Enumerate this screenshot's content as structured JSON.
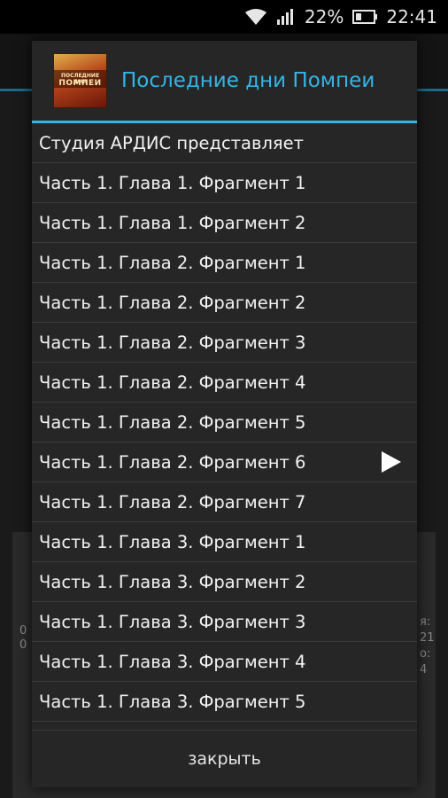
{
  "status_bar": {
    "battery_percent": "22%",
    "time": "22:41"
  },
  "dialog": {
    "title": "Последние дни Помпеи",
    "cover": {
      "line1": "ПОСЛЕДНИЕ ДНИ",
      "line2": "ПОМПЕИ"
    },
    "items": [
      {
        "label": "Студия АРДИС представляет",
        "playing": false
      },
      {
        "label": "Часть 1. Глава 1. Фрагмент 1",
        "playing": false
      },
      {
        "label": "Часть 1. Глава 1. Фрагмент 2",
        "playing": false
      },
      {
        "label": "Часть 1. Глава 2. Фрагмент 1",
        "playing": false
      },
      {
        "label": "Часть 1. Глава 2. Фрагмент 2",
        "playing": false
      },
      {
        "label": "Часть 1. Глава 2. Фрагмент 3",
        "playing": false
      },
      {
        "label": "Часть 1. Глава 2. Фрагмент 4",
        "playing": false
      },
      {
        "label": "Часть 1. Глава 2. Фрагмент 5",
        "playing": false
      },
      {
        "label": "Часть 1. Глава 2. Фрагмент 6",
        "playing": true
      },
      {
        "label": "Часть 1. Глава 2. Фрагмент 7",
        "playing": false
      },
      {
        "label": "Часть 1. Глава 3. Фрагмент 1",
        "playing": false
      },
      {
        "label": "Часть 1. Глава 3. Фрагмент 2",
        "playing": false
      },
      {
        "label": "Часть 1. Глава 3. Фрагмент 3",
        "playing": false
      },
      {
        "label": "Часть 1. Глава 3. Фрагмент 4",
        "playing": false
      },
      {
        "label": "Часть 1. Глава 3. Фрагмент 5",
        "playing": false
      }
    ],
    "close_label": "закрыть"
  },
  "background_fragments": {
    "left_1": "0",
    "left_2": "0",
    "right_1": "я:",
    "right_2": "21",
    "right_3": "о:",
    "right_4": "4"
  }
}
